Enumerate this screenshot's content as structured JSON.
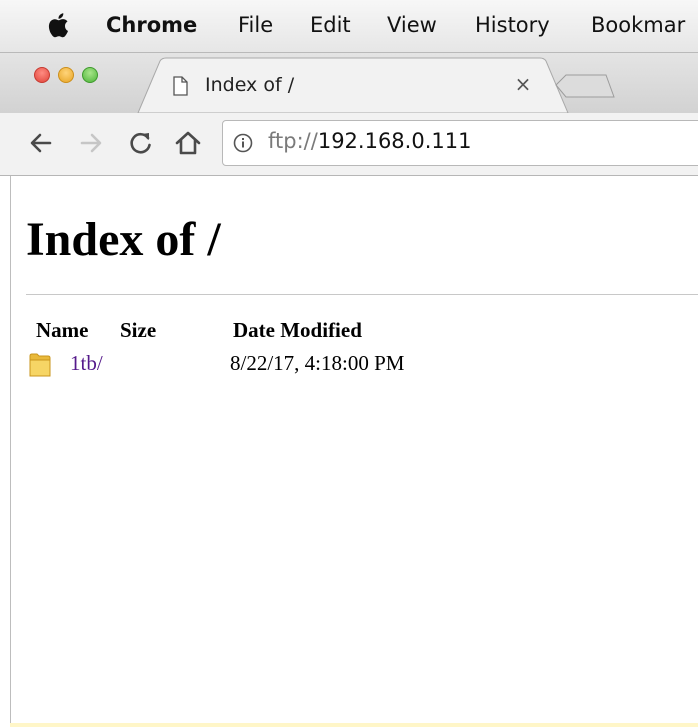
{
  "menubar": {
    "app_name": "Chrome",
    "items": [
      "File",
      "Edit",
      "View",
      "History",
      "Bookmar"
    ]
  },
  "tab": {
    "title": "Index of /",
    "close_glyph": "×"
  },
  "omnibox": {
    "scheme": "ftp://",
    "host": "192.168.0.111"
  },
  "page": {
    "title": "Index of /",
    "columns": [
      "Name",
      "Size",
      "Date Modified"
    ],
    "rows": [
      {
        "name": "1tb/",
        "size": "",
        "date": "8/22/17, 4:18:00 PM",
        "icon": "folder-icon"
      }
    ]
  },
  "colors": {
    "visited_link": "#551a8b",
    "folder": "#f2c94c"
  }
}
